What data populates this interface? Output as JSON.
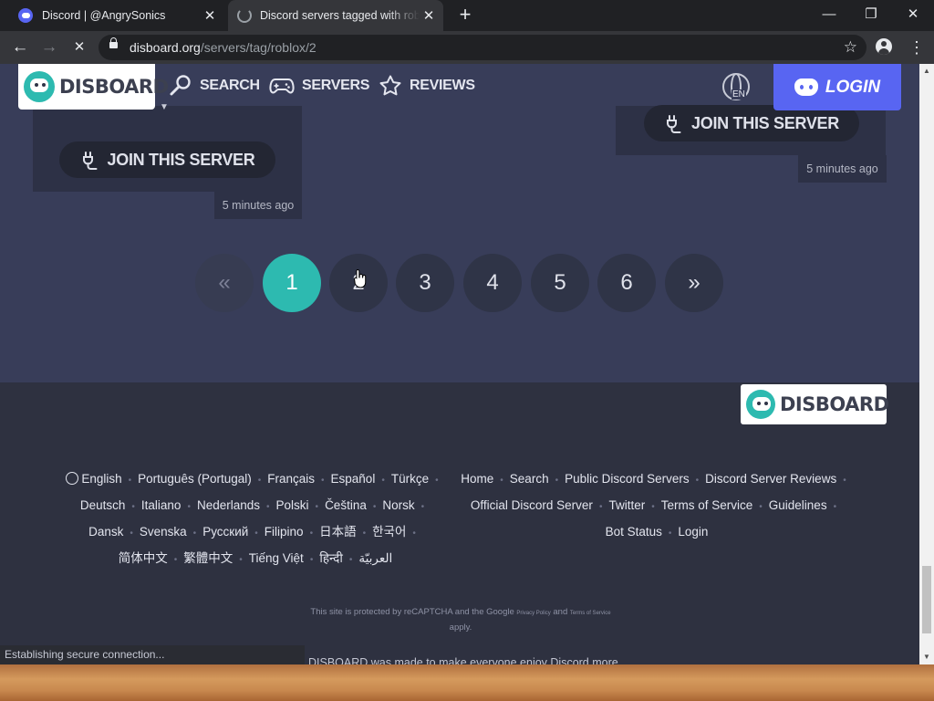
{
  "browser": {
    "tabs": [
      {
        "title": "Discord | @AngrySonics",
        "active": false
      },
      {
        "title": "Discord servers tagged with roblox",
        "active": true
      }
    ],
    "url_host": "disboard.org",
    "url_path": "/servers/tag/roblox/2",
    "status_text": "Establishing secure connection..."
  },
  "site": {
    "brand": "DISBOARD",
    "nav": {
      "search": "SEARCH",
      "servers": "SERVERS",
      "reviews": "REVIEWS"
    },
    "language_code": "EN",
    "login": "LOGIN",
    "accent": "#2dbab0",
    "discord_color": "#5865f2"
  },
  "cards": {
    "left": {
      "join": "JOIN THIS SERVER",
      "time": "5 minutes ago"
    },
    "right": {
      "join": "JOIN THIS SERVER",
      "time": "5 minutes ago"
    }
  },
  "pagination": {
    "prev": "«",
    "pages": [
      "1",
      "2",
      "3",
      "4",
      "5",
      "6"
    ],
    "next": "»",
    "active_page": "1"
  },
  "footer": {
    "brand": "DISBOARD",
    "languages": [
      "English",
      "Português (Portugal)",
      "Français",
      "Español",
      "Türkçe",
      "Deutsch",
      "Italiano",
      "Nederlands",
      "Polski",
      "Čeština",
      "Norsk",
      "Dansk",
      "Svenska",
      "Русский",
      "Filipino",
      "日本語",
      "한국어",
      "简体中文",
      "繁體中文",
      "Tiếng Việt",
      "हिन्दी",
      "العربيّة"
    ],
    "links": [
      "Home",
      "Search",
      "Public Discord Servers",
      "Discord Server Reviews",
      "Official Discord Server",
      "Twitter",
      "Terms of Service",
      "Guidelines",
      "Bot Status",
      "Login"
    ],
    "recaptcha": {
      "prefix": "This site is protected by reCAPTCHA and the Google",
      "privacy": "Privacy Policy",
      "and": "and",
      "terms": "Terms of Service",
      "suffix": "apply."
    },
    "made_with": "DISBOARD was made to make everyone enjoy Discord more."
  }
}
